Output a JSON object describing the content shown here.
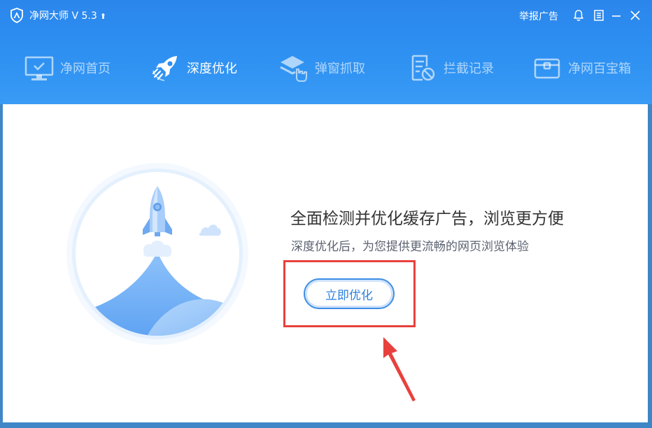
{
  "app": {
    "title": "净网大师 V 5.3",
    "update_arrow": "⬆",
    "report_ad": "举报广告"
  },
  "nav": [
    {
      "label": "净网首页",
      "icon": "monitor-check-icon",
      "active": false
    },
    {
      "label": "深度优化",
      "icon": "rocket-icon",
      "active": true
    },
    {
      "label": "弹窗抓取",
      "icon": "layers-hand-icon",
      "active": false
    },
    {
      "label": "拦截记录",
      "icon": "document-block-icon",
      "active": false
    },
    {
      "label": "净网百宝箱",
      "icon": "toolbox-icon",
      "active": false
    }
  ],
  "main": {
    "headline": "全面检测并优化缓存广告，浏览更方便",
    "subline": "深度优化后，为您提供更流畅的网页浏览体验",
    "cta_label": "立即优化"
  },
  "colors": {
    "header_blue": "#2f8ef0",
    "accent_blue": "#2a7fdc",
    "highlight_red": "#e8413d"
  }
}
